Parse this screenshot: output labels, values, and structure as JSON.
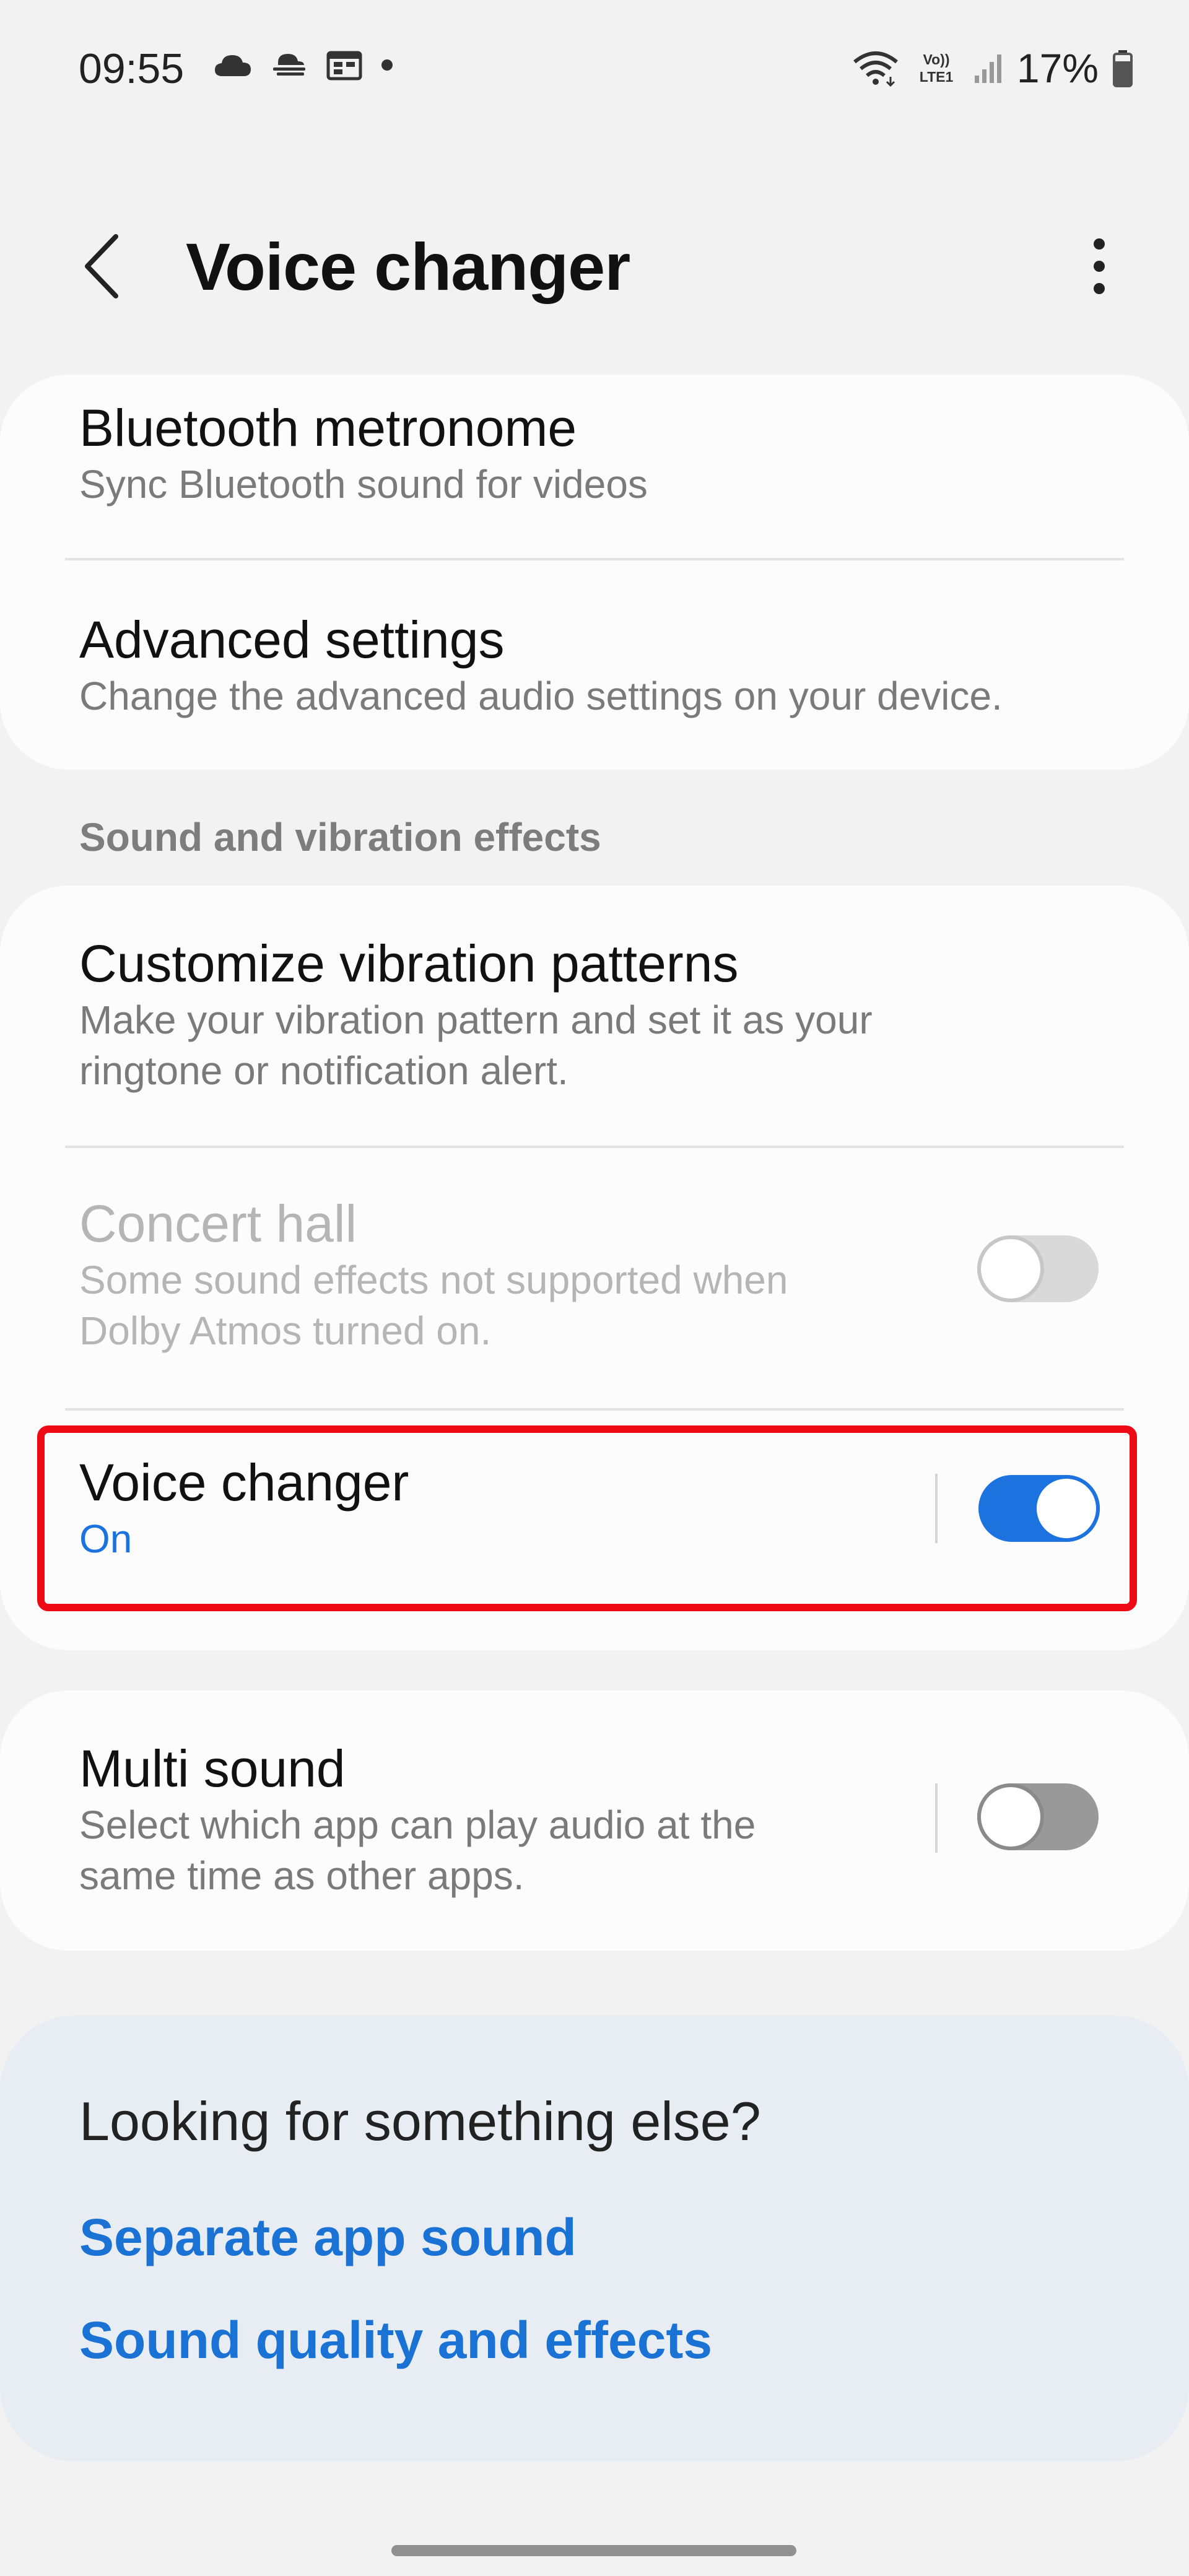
{
  "status_bar": {
    "time": "09:55",
    "battery": "17%",
    "left_icons": [
      "cloud-icon",
      "weather-fog-icon",
      "calendar-icon",
      "dot-icon"
    ],
    "right_icons": [
      "wifi-icon",
      "volte-icon",
      "signal-icon",
      "battery-icon"
    ],
    "volte_label_top": "Vo))",
    "volte_label_bottom": "LTE1"
  },
  "header": {
    "title": "Voice changer",
    "back_icon": "back-arrow-icon",
    "more_icon": "more-vertical-icon"
  },
  "card1": {
    "items": [
      {
        "title": "Bluetooth metronome",
        "subtitle": "Sync Bluetooth sound for videos"
      },
      {
        "title": "Advanced settings",
        "subtitle": "Change the advanced audio settings on your device."
      }
    ]
  },
  "section": {
    "label": "Sound and vibration effects"
  },
  "card2": {
    "items": [
      {
        "title": "Customize vibration patterns",
        "subtitle_lines": [
          "Make your vibration pattern and set it as your",
          "ringtone or notification alert."
        ]
      },
      {
        "title": "Concert hall",
        "subtitle_lines": [
          "Some sound effects not supported when",
          "Dolby Atmos turned on."
        ],
        "enabled": false,
        "toggle": false
      },
      {
        "title": "Voice changer",
        "status": "On",
        "toggle": true,
        "highlighted": true
      }
    ]
  },
  "card3": {
    "items": [
      {
        "title": "Multi sound",
        "subtitle_lines": [
          "Select which app can play audio at the",
          "same time as other apps."
        ],
        "toggle": false
      }
    ]
  },
  "suggestions": {
    "title": "Looking for something else?",
    "links": [
      "Separate app sound",
      "Sound quality and effects"
    ]
  },
  "colors": {
    "accent": "#1c73df",
    "highlight": "#ee0a14",
    "background": "#f2f2f2",
    "card": "#fcfcfc",
    "suggest_card": "#e8edf4"
  }
}
